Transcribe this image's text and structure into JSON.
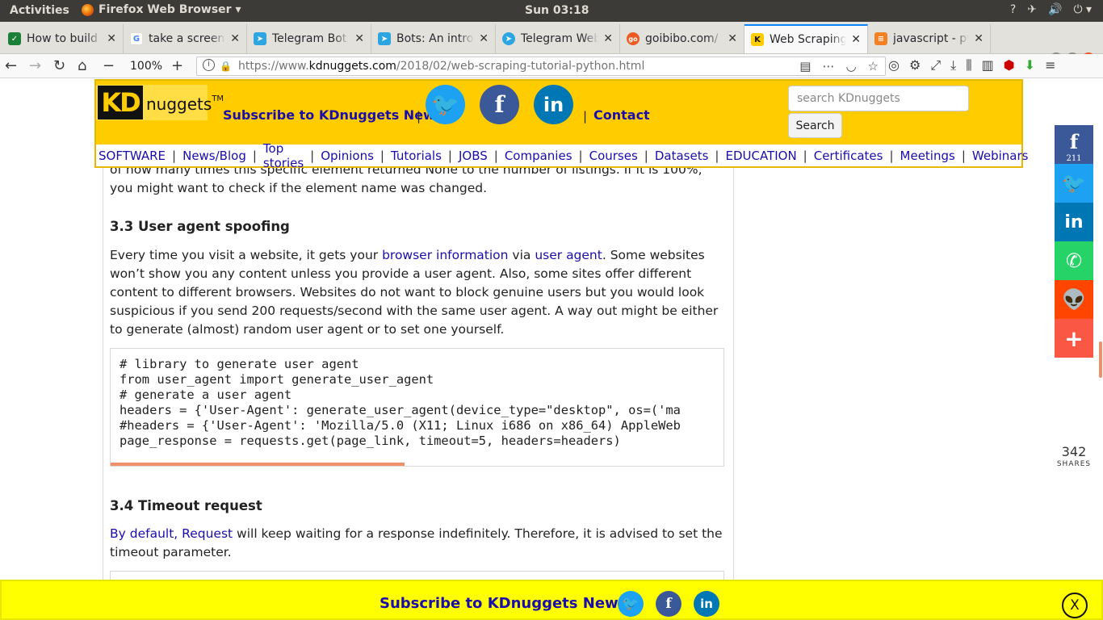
{
  "os": {
    "activities": "Activities",
    "app_name": "Firefox Web Browser ▾",
    "clock": "Sun 03:18",
    "tray": [
      "?",
      "✈",
      "🔊",
      "⏻ ▾"
    ]
  },
  "tabs": [
    {
      "title": "How to build a",
      "favicon_color": "#1a7f37",
      "glyph": "✓"
    },
    {
      "title": "take a screenshot",
      "favicon_color": "#ffffff",
      "glyph": "G"
    },
    {
      "title": "Telegram Bot",
      "favicon_color": "#2ca5e0",
      "glyph": "➤"
    },
    {
      "title": "Bots: An intro",
      "favicon_color": "#2ca5e0",
      "glyph": "➤"
    },
    {
      "title": "Telegram Web",
      "favicon_color": "#2ca5e0",
      "glyph": "➤"
    },
    {
      "title": "goibibo.com/",
      "favicon_color": "#ee5a24",
      "glyph": "go"
    },
    {
      "title": "Web Scraping",
      "favicon_color": "#111111",
      "glyph": "K",
      "active": true
    },
    {
      "title": "javascript - py",
      "favicon_color": "#f48024",
      "glyph": "≡"
    }
  ],
  "nav": {
    "zoom": "100%",
    "url_prefix": "https://www.",
    "url_domain": "kdnuggets.com",
    "url_path": "/2018/02/web-scraping-tutorial-python.html"
  },
  "kd": {
    "logo_kd": "KD",
    "logo_text": "nuggets",
    "logo_tm": "TM",
    "subscribe": "Subscribe to KDnuggets News",
    "sep": "|",
    "contact": "Contact",
    "search_placeholder": "search KDnuggets",
    "search_button": "Search",
    "menu": [
      "SOFTWARE",
      "News/Blog",
      "Top stories",
      "Opinions",
      "Tutorials",
      "JOBS",
      "Companies",
      "Courses",
      "Datasets",
      "EDUCATION",
      "Certificates",
      "Meetings",
      "Webinars"
    ]
  },
  "article": {
    "para1": "of how many times this specific element returned None to the number of listings. If it is 100%, you might want to check if the element name was changed.",
    "h33": "3.3 User agent spoofing",
    "p2_a": "Every time you visit a website, it gets your ",
    "p2_link1": "browser information",
    "p2_b": " via ",
    "p2_link2": "user agent",
    "p2_c": ". Some websites won’t show you any content unless you provide a user agent. Also, some sites offer different content to different browsers. Websites do not want to block genuine users but you would look suspicious if you send 200 requests/second with the same user agent. A way out might be either to generate (almost) random user agent or to set one yourself.",
    "code": "# library to generate user agent\nfrom user_agent import generate_user_agent\n# generate a user agent\nheaders = {'User-Agent': generate_user_agent(device_type=\"desktop\", os=('ma\n#headers = {'User-Agent': 'Mozilla/5.0 (X11; Linux i686 on x86_64) AppleWeb\npage_response = requests.get(page_link, timeout=5, headers=headers)",
    "h34": "3.4 Timeout request",
    "p3_link1": "By default",
    "p3_comma": ", ",
    "p3_link2": "Request",
    "p3_rest": " will keep waiting for a response indefinitely. Therefore, it is advised to set the timeout parameter."
  },
  "share": {
    "facebook_count": "211",
    "total": "342",
    "label": "SHARES",
    "colors": {
      "facebook": "#3b5998",
      "twitter": "#1da1f2",
      "linkedin": "#0077b5",
      "whatsapp": "#25d366",
      "reddit": "#ff4500",
      "more": "#fa5745"
    }
  },
  "bottom": {
    "subscribe": "Subscribe to KDnuggets News",
    "close": "X"
  }
}
